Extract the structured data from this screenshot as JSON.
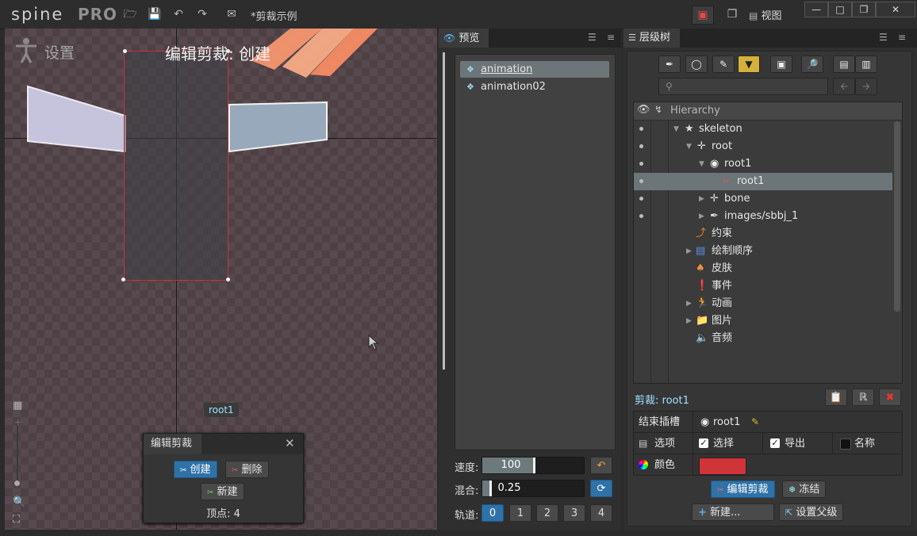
{
  "app": {
    "logo": "spine",
    "edition": "PRO",
    "document_title": "*剪裁示例",
    "view_menu": "视图"
  },
  "viewport": {
    "mode_label": "设置",
    "title": "编辑剪裁: 创建",
    "bone_tag": "root1"
  },
  "clip_panel": {
    "title": "编辑剪裁",
    "create_label": "创建",
    "delete_label": "删除",
    "new_label": "新建",
    "vertices_label": "顶点: 4"
  },
  "preview": {
    "tab": "预览",
    "animations": [
      "animation",
      "animation02"
    ],
    "speed_label": "速度:",
    "speed_value": "100",
    "speed_fraction": 0.5,
    "mix_label": "混合:",
    "mix_value": "0.25",
    "mix_fraction": 0.07,
    "track_label": "轨道:",
    "tracks": [
      "0",
      "1",
      "2",
      "3",
      "4"
    ],
    "active_track": "0"
  },
  "tree": {
    "tab": "层级树",
    "column_header": "Hierarchy",
    "rows": {
      "skeleton": "skeleton",
      "root": "root",
      "slot": "root1",
      "clipping": "root1",
      "bone": "bone",
      "images": "images/sbbj_1",
      "constraints": "约束",
      "draw_order": "绘制顺序",
      "skins": "皮肤",
      "events": "事件",
      "animations": "动画",
      "images_folder": "图片",
      "audio": "音频"
    },
    "clip_title": "剪裁: root1",
    "end_slot_label": "结束插槽",
    "end_slot_value": "root1",
    "options_label": "选项",
    "option_select": "选择",
    "option_export": "导出",
    "option_name": "名称",
    "color_label": "颜色",
    "edit_clip_button": "编辑剪裁",
    "freeze_button": "冻结",
    "new_button": "新建...",
    "set_parent_button": "设置父级"
  },
  "colors": {
    "accent": "#2f72a8",
    "selection": "#6c7577",
    "clip_color": "#cf3438",
    "clip_outline": "#c8343c"
  }
}
